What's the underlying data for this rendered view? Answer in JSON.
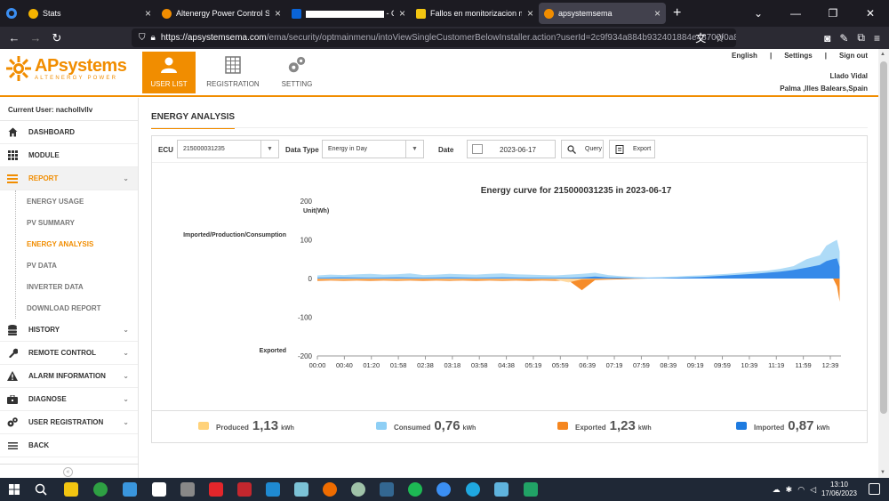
{
  "browser": {
    "tabs": [
      {
        "label": "Stats",
        "color": "#f5b400",
        "active": false
      },
      {
        "label": "Altenergy Power Control Software",
        "color": "#f18d00",
        "active": false
      },
      {
        "label": "",
        "suffix": "- Cl",
        "color": "#0a64d8",
        "active": false
      },
      {
        "label": "Fallos en monitorizacion micro",
        "color": "#f2c511",
        "active": false
      },
      {
        "label": "apsystemsema",
        "color": "#f18d00",
        "active": true
      }
    ],
    "url_host": "https://apsystemsema.com",
    "url_path": "/ema/security/optmainmenu/intoViewSingleCustomerBelowInstaller.action?userId=2c9f934a884b932401884e48700f0a80&"
  },
  "header": {
    "logo_name": "APsystems",
    "logo_tagline": "ALTENERGY POWER",
    "nav": [
      {
        "label": "USER LIST",
        "active": true
      },
      {
        "label": "REGISTRATION",
        "active": false
      },
      {
        "label": "SETTING",
        "active": false
      }
    ],
    "links": {
      "language": "English",
      "settings": "Settings",
      "signout": "Sign out",
      "sep": "|"
    },
    "user_name": "Llado Vidal",
    "user_location": "Palma ,Illes Balears,Spain"
  },
  "sidebar": {
    "current_user": "Current User: nachollvllv",
    "items": [
      {
        "label": "DASHBOARD",
        "icon": "home-icon"
      },
      {
        "label": "MODULE",
        "icon": "grid-icon"
      },
      {
        "label": "REPORT",
        "icon": "list-icon",
        "active": true
      },
      {
        "label": "HISTORY",
        "icon": "database-icon"
      },
      {
        "label": "REMOTE CONTROL",
        "icon": "wrench-icon"
      },
      {
        "label": "ALARM INFORMATION",
        "icon": "warning-icon"
      },
      {
        "label": "DIAGNOSE",
        "icon": "briefcase-icon"
      },
      {
        "label": "USER REGISTRATION",
        "icon": "gears-icon"
      },
      {
        "label": "BACK",
        "icon": "back-icon"
      }
    ],
    "report_sub": [
      {
        "label": "ENERGY USAGE"
      },
      {
        "label": "PV SUMMARY"
      },
      {
        "label": "ENERGY ANALYSIS",
        "active": true
      },
      {
        "label": "PV DATA"
      },
      {
        "label": "INVERTER DATA"
      },
      {
        "label": "DOWNLOAD REPORT"
      }
    ]
  },
  "main": {
    "title": "ENERGY ANALYSIS",
    "filters": {
      "ecu_label": "ECU",
      "ecu_value": "215000031235",
      "datatype_label": "Data Type",
      "datatype_value": "Energy in Day",
      "date_label": "Date",
      "date_value": "2023-06-17",
      "query_label": "Query",
      "export_label": "Export"
    },
    "chart_title": "Energy curve for 215000031235 in 2023-06-17",
    "unit_label": "Unit(Wh)",
    "side_label_top": "Imported/Production/Consumption",
    "side_label_bottom": "Exported"
  },
  "legend": [
    {
      "name": "Produced",
      "value": "1,13",
      "unit": "kWh",
      "color": "#ffd27a"
    },
    {
      "name": "Consumed",
      "value": "0,76",
      "unit": "kWh",
      "color": "#8ecff5"
    },
    {
      "name": "Exported",
      "value": "1,23",
      "unit": "kWh",
      "color": "#f5861f"
    },
    {
      "name": "Imported",
      "value": "0,87",
      "unit": "kWh",
      "color": "#1e7be0"
    }
  ],
  "chart_data": {
    "type": "area",
    "title": "Energy curve for 215000031235 in 2023-06-17",
    "ylabel": "Unit(Wh)",
    "ylim": [
      -200,
      200
    ],
    "yticks": [
      200,
      100,
      0,
      -100,
      -200
    ],
    "xticks": [
      "00:00",
      "00:40",
      "01:20",
      "01:58",
      "02:38",
      "03:18",
      "03:58",
      "04:38",
      "05:19",
      "05:59",
      "06:39",
      "07:19",
      "07:59",
      "08:39",
      "09:19",
      "09:59",
      "10:39",
      "11:19",
      "11:59",
      "12:39"
    ],
    "grid": false,
    "x_minutes_max": 792,
    "series": [
      {
        "name": "Consumed",
        "color": "#aad9f7",
        "x": [
          0,
          20,
          40,
          60,
          80,
          100,
          120,
          140,
          160,
          180,
          200,
          220,
          240,
          260,
          280,
          300,
          320,
          340,
          360,
          380,
          400,
          420,
          440,
          460,
          480,
          500,
          520,
          540,
          560,
          580,
          600,
          620,
          640,
          660,
          680,
          700,
          720,
          740,
          760,
          770,
          780,
          786,
          790
        ],
        "values": [
          8,
          10,
          9,
          11,
          12,
          10,
          11,
          13,
          9,
          10,
          12,
          11,
          10,
          12,
          13,
          11,
          10,
          9,
          8,
          10,
          12,
          15,
          9,
          6,
          4,
          3,
          4,
          5,
          7,
          8,
          10,
          12,
          15,
          18,
          20,
          25,
          32,
          50,
          60,
          85,
          95,
          100,
          70
        ]
      },
      {
        "name": "Imported",
        "color": "#2f86e8",
        "x": [
          0,
          40,
          80,
          120,
          160,
          200,
          240,
          280,
          320,
          360,
          380,
          400,
          420,
          440,
          460,
          480,
          500,
          520,
          540,
          560,
          580,
          600,
          620,
          640,
          660,
          680,
          700,
          720,
          740,
          760,
          770,
          780,
          786,
          790
        ],
        "values": [
          2,
          3,
          2,
          3,
          2,
          3,
          2,
          3,
          2,
          2,
          2,
          3,
          5,
          3,
          2,
          1,
          1,
          1,
          2,
          3,
          4,
          6,
          8,
          10,
          12,
          15,
          18,
          22,
          28,
          35,
          45,
          50,
          52,
          30
        ]
      },
      {
        "name": "Exported",
        "color": "#f5861f",
        "x": [
          0,
          20,
          40,
          60,
          80,
          100,
          120,
          140,
          160,
          180,
          200,
          220,
          240,
          260,
          280,
          300,
          320,
          340,
          360,
          380,
          400,
          420,
          440,
          460,
          480,
          500,
          520,
          540,
          560,
          580,
          600,
          620,
          640,
          660,
          680,
          700,
          720,
          740,
          760,
          780,
          786,
          790
        ],
        "values": [
          -6,
          -5,
          -6,
          -5,
          -6,
          -5,
          -6,
          -5,
          -6,
          -5,
          -6,
          -5,
          -6,
          -5,
          -6,
          -5,
          -6,
          -5,
          -6,
          -5,
          -30,
          -4,
          -3,
          -2,
          -1,
          0,
          0,
          0,
          0,
          0,
          0,
          0,
          0,
          0,
          0,
          0,
          0,
          0,
          0,
          0,
          -20,
          -60
        ]
      },
      {
        "name": "Produced",
        "color": "#ffd9a0",
        "x": [
          0,
          40,
          80,
          120,
          160,
          200,
          240,
          280,
          320,
          360,
          380,
          400,
          420,
          440,
          460,
          480,
          500,
          520,
          790
        ],
        "values": [
          -2,
          -3,
          -2,
          -3,
          -2,
          -3,
          -2,
          -3,
          -2,
          -3,
          -10,
          -2,
          -1,
          -1,
          0,
          0,
          0,
          0,
          0
        ]
      }
    ]
  }
}
